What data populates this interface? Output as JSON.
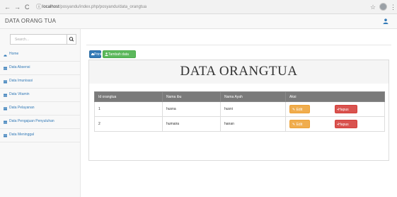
{
  "browser": {
    "back_glyph": "←",
    "forward_glyph": "→",
    "reload_glyph": "C",
    "info_glyph": "ⓘ",
    "url_host": "localhost",
    "url_path": "/posyandu/index.php/posyandu/data_orangtua",
    "star_glyph": "☆",
    "menu_glyph": "⋮"
  },
  "app": {
    "brand": "DATA ORANG TUA",
    "accent": "#337ab7"
  },
  "sidebar": {
    "search_placeholder": "Search...",
    "items": [
      {
        "label": "Home",
        "icon": "dashboard-icon"
      },
      {
        "label": "Data Absensi",
        "icon": "table-icon"
      },
      {
        "label": "Data Imunisasi",
        "icon": "table-icon"
      },
      {
        "label": "Data Vitamin",
        "icon": "table-icon"
      },
      {
        "label": "Data Pelayanan",
        "icon": "table-icon"
      },
      {
        "label": "Data Pengajuan Penyuluhan",
        "icon": "table-icon"
      },
      {
        "label": "Data Meninggal",
        "icon": "table-icon"
      }
    ]
  },
  "toolbar": {
    "print_label": "Print",
    "add_label": "Tambah data"
  },
  "panel": {
    "title": "DATA ORANGTUA"
  },
  "table": {
    "headers": [
      "Id orangtua",
      "Nama ibu",
      "Nama Ayah",
      "Aksi"
    ],
    "rows": [
      {
        "id": "1",
        "ibu": "husna",
        "ayah": "husni",
        "edit": "Edit",
        "hapus": "Hapus"
      },
      {
        "id": "2",
        "ibu": "humaira",
        "ayah": "hanan",
        "edit": "Edit",
        "hapus": "Hapus"
      }
    ]
  }
}
